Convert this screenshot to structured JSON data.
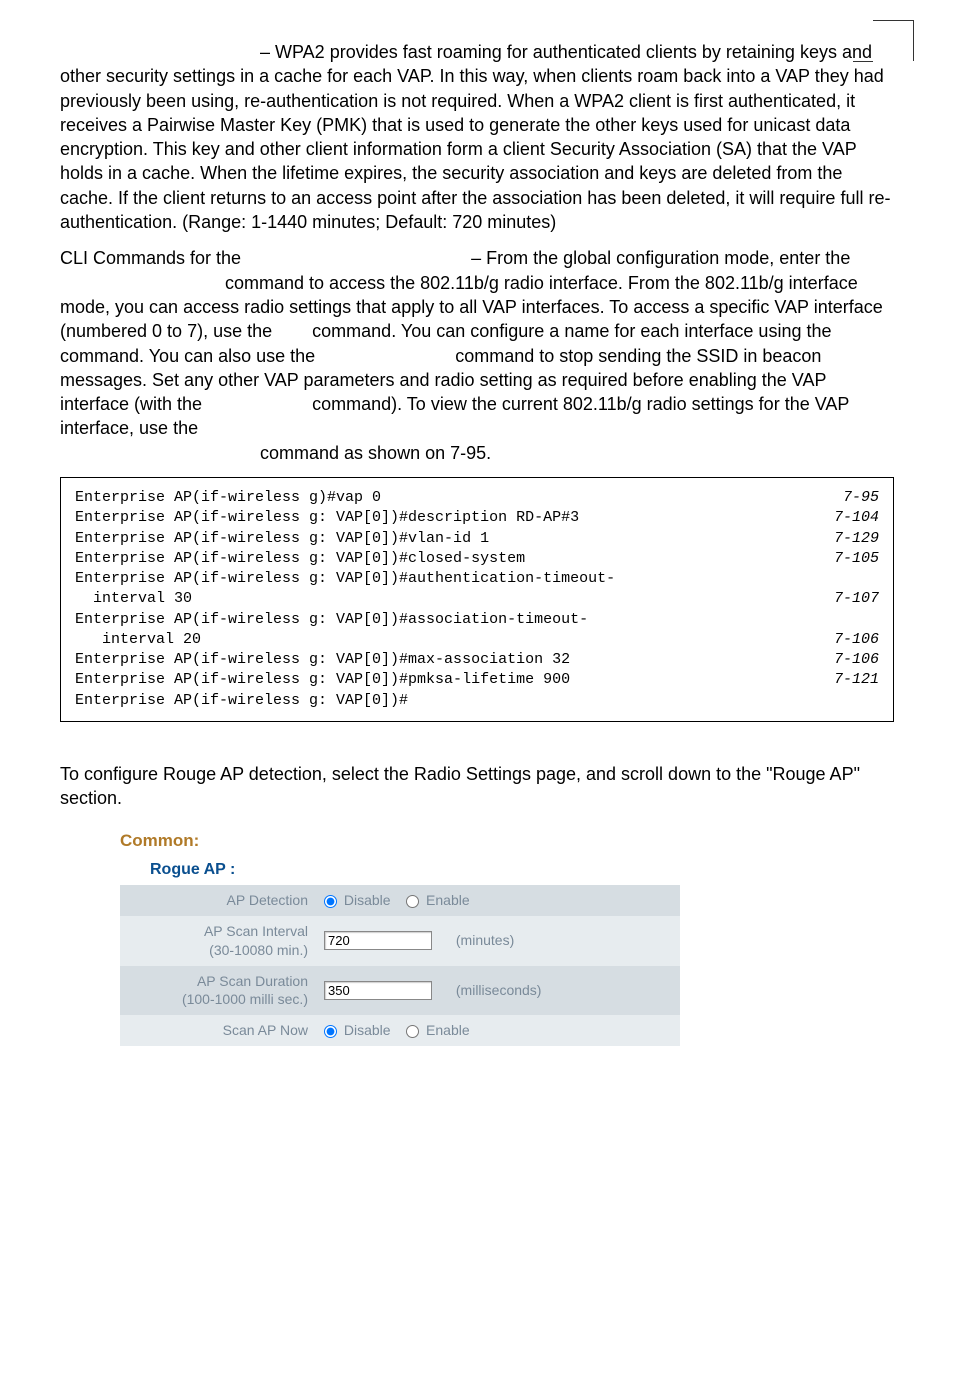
{
  "para1_lead": "– WPA2 provides fast roaming for authenticated clients by retaining keys and other security settings in a cache for each VAP. In this way, when clients roam back into a VAP they had previously been using, re-authentication is not required. When a WPA2 client is first authenticated, it receives a Pairwise Master Key (PMK) that is used to generate the other keys used for unicast data encryption. This key and other client information form a client Security Association (SA) that the VAP holds in a cache. When the lifetime expires, the security association and keys are deleted from the cache. If the client returns to an access point after the association has been deleted, it will require full re-authentication. (Range: 1-1440 minutes; Default: 720 minutes)",
  "para2_a": "CLI Commands for the",
  "para2_b": "– From the global configuration mode, enter the",
  "para2_c": "command to access the 802.11b/g radio interface. From the 802.11b/g interface mode, you can access radio settings that apply to all VAP interfaces. To access a specific VAP interface (numbered 0 to 7), use the",
  "para2_d": "command. You can configure a name for each interface using the",
  "para2_e": "command. You can also use the",
  "para2_f": "command to stop sending the SSID in beacon messages. Set any other VAP parameters and radio setting  as required before enabling the VAP interface (with the",
  "para2_g": "command). To view the current 802.11b/g radio settings for the VAP interface, use the",
  "para2_h": "command as shown on 7-95.",
  "cli": [
    {
      "cmd": "Enterprise AP(if-wireless g)#vap 0",
      "ref": "7-95"
    },
    {
      "cmd": "Enterprise AP(if-wireless g: VAP[0])#description RD-AP#3",
      "ref": "7-104"
    },
    {
      "cmd": "Enterprise AP(if-wireless g: VAP[0])#vlan-id 1",
      "ref": "7-129"
    },
    {
      "cmd": "Enterprise AP(if-wireless g: VAP[0])#closed-system",
      "ref": "7-105"
    },
    {
      "cmd": "Enterprise AP(if-wireless g: VAP[0])#authentication-timeout-",
      "ref": ""
    },
    {
      "cmd": "  interval 30",
      "ref": "7-107"
    },
    {
      "cmd": "Enterprise AP(if-wireless g: VAP[0])#association-timeout-",
      "ref": ""
    },
    {
      "cmd": "   interval 20",
      "ref": "7-106"
    },
    {
      "cmd": "Enterprise AP(if-wireless g: VAP[0])#max-association 32",
      "ref": "7-106"
    },
    {
      "cmd": "Enterprise AP(if-wireless g: VAP[0])#pmksa-lifetime 900",
      "ref": "7-121"
    },
    {
      "cmd": "Enterprise AP(if-wireless g: VAP[0])#",
      "ref": ""
    }
  ],
  "para3": "To configure Rouge AP detection, select the Radio Settings page, and scroll down to the \"Rouge AP\" section.",
  "panel": {
    "common": "Common:",
    "rogue": "Rogue AP :",
    "rows": {
      "detection_label": "AP Detection",
      "disable": "Disable",
      "enable": "Enable",
      "scan_interval_label": "AP Scan Interval",
      "scan_interval_sub": "(30-10080 min.)",
      "scan_interval_value": "720",
      "minutes": "(minutes)",
      "scan_duration_label": "AP Scan Duration",
      "scan_duration_sub": "(100-1000 milli sec.)",
      "scan_duration_value": "350",
      "milliseconds": "(milliseconds)",
      "scan_now_label": "Scan AP Now"
    }
  }
}
